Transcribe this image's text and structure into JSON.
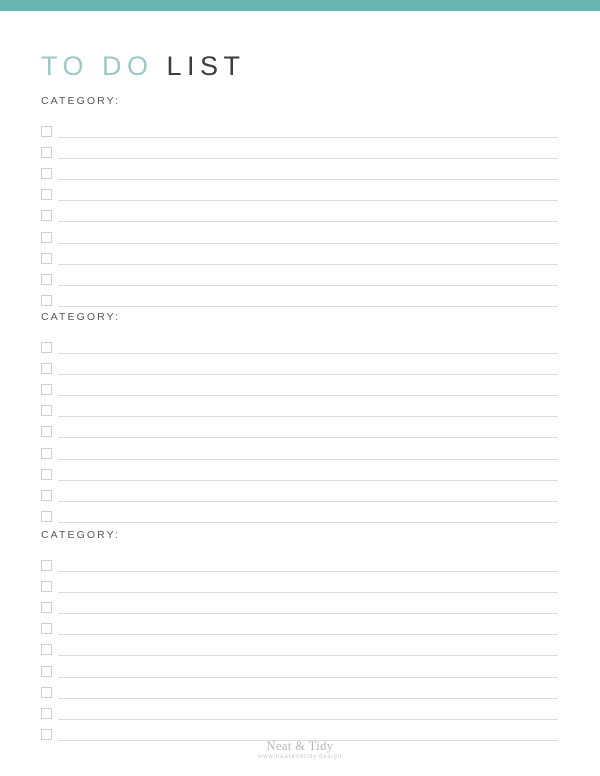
{
  "page": {
    "accent_color": "#67b4b1",
    "title_accent_color": "#9ec9c6",
    "title_dark_color": "#3c3c3c",
    "background_color": "#ffffff"
  },
  "title": {
    "part_accent": "TO DO",
    "part_dark": "LIST",
    "full": "TO DO LIST"
  },
  "sections": [
    {
      "label": "CATEGORY:",
      "row_count": 9,
      "rows": [
        {
          "checked": false,
          "text": ""
        },
        {
          "checked": false,
          "text": ""
        },
        {
          "checked": false,
          "text": ""
        },
        {
          "checked": false,
          "text": ""
        },
        {
          "checked": false,
          "text": ""
        },
        {
          "checked": false,
          "text": ""
        },
        {
          "checked": false,
          "text": ""
        },
        {
          "checked": false,
          "text": ""
        },
        {
          "checked": false,
          "text": ""
        }
      ]
    },
    {
      "label": "CATEGORY:",
      "row_count": 9,
      "rows": [
        {
          "checked": false,
          "text": ""
        },
        {
          "checked": false,
          "text": ""
        },
        {
          "checked": false,
          "text": ""
        },
        {
          "checked": false,
          "text": ""
        },
        {
          "checked": false,
          "text": ""
        },
        {
          "checked": false,
          "text": ""
        },
        {
          "checked": false,
          "text": ""
        },
        {
          "checked": false,
          "text": ""
        },
        {
          "checked": false,
          "text": ""
        }
      ]
    },
    {
      "label": "CATEGORY:",
      "row_count": 9,
      "rows": [
        {
          "checked": false,
          "text": ""
        },
        {
          "checked": false,
          "text": ""
        },
        {
          "checked": false,
          "text": ""
        },
        {
          "checked": false,
          "text": ""
        },
        {
          "checked": false,
          "text": ""
        },
        {
          "checked": false,
          "text": ""
        },
        {
          "checked": false,
          "text": ""
        },
        {
          "checked": false,
          "text": ""
        },
        {
          "checked": false,
          "text": ""
        }
      ]
    }
  ],
  "footer": {
    "brand": "Neat & Tidy",
    "url": "www.neatandtidy.design"
  }
}
